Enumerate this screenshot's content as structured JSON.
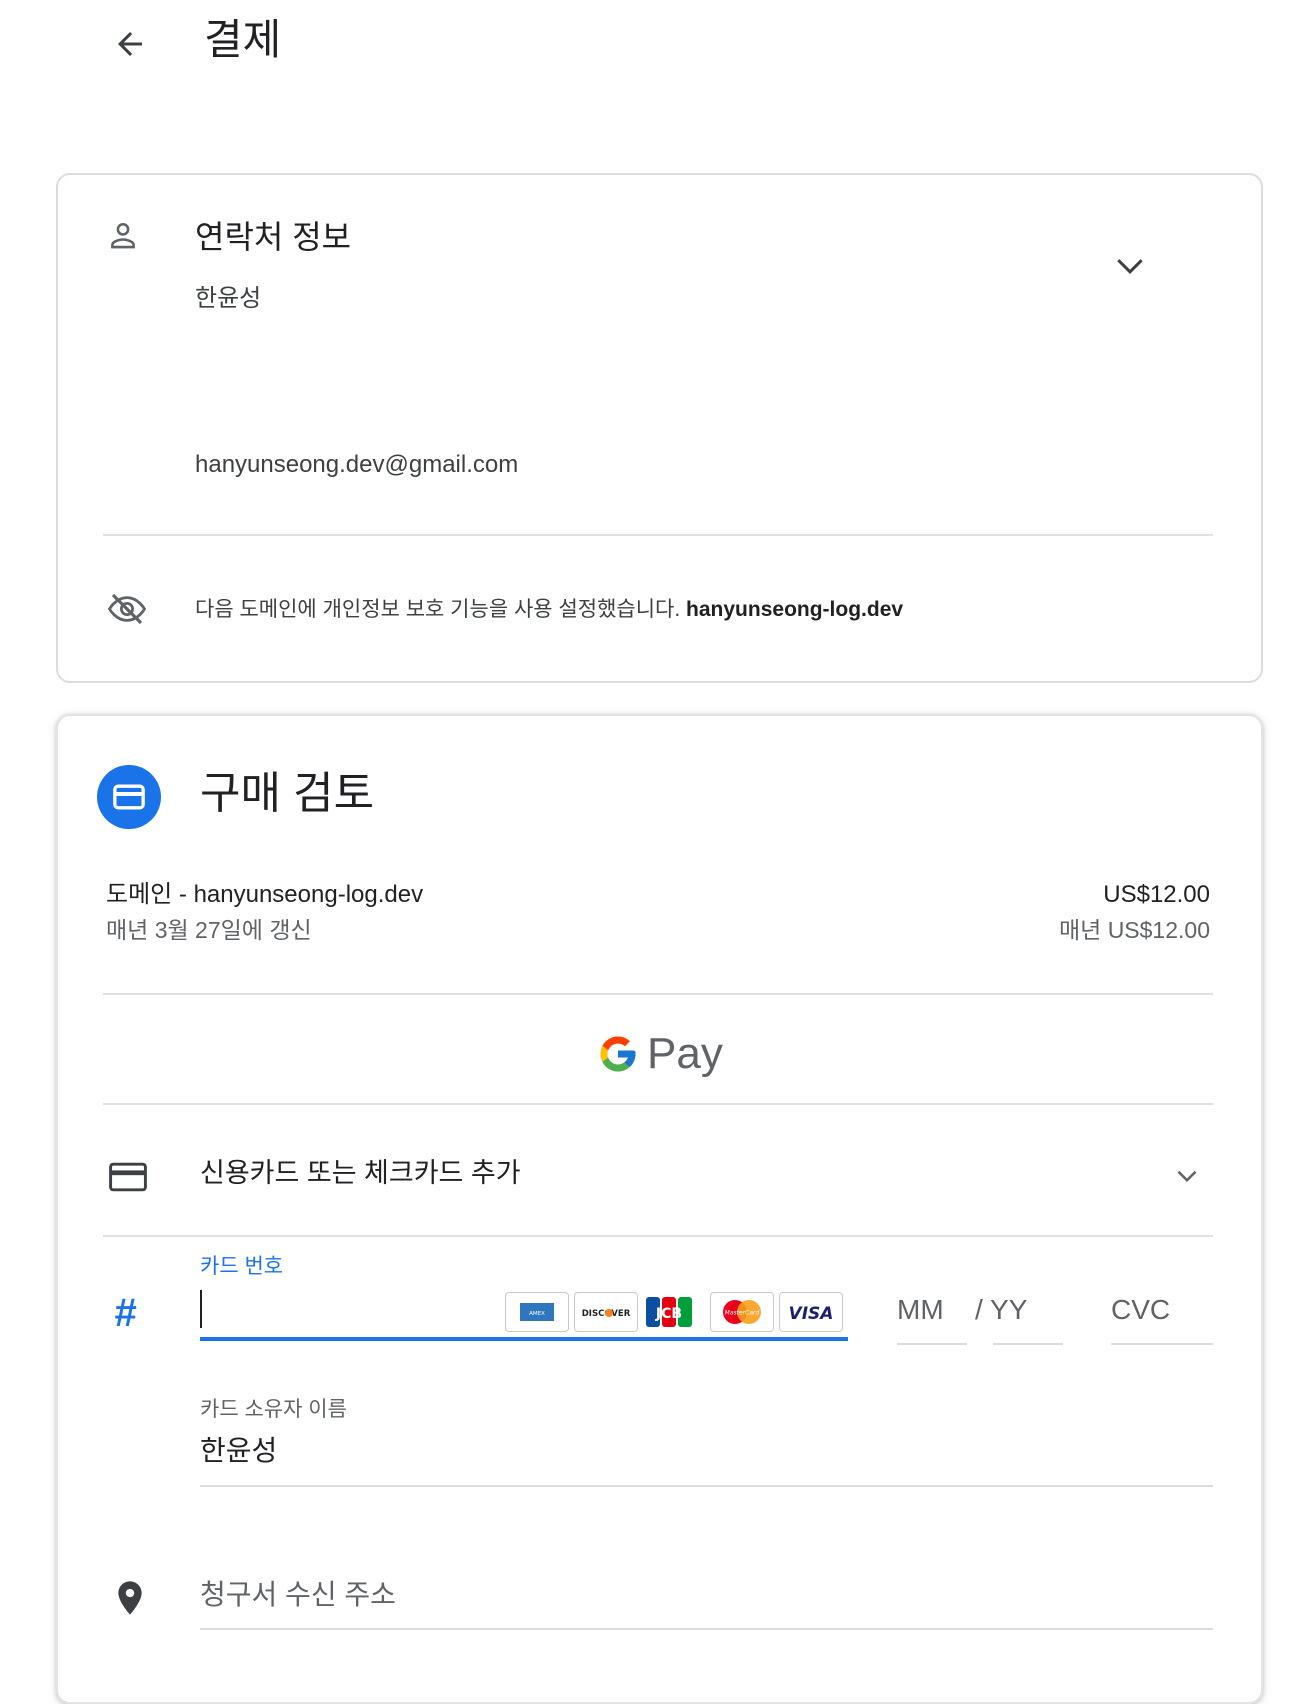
{
  "header": {
    "back_icon": "arrow-left-icon",
    "title": "결제"
  },
  "contact": {
    "icon": "person-icon",
    "title": "연락처 정보",
    "name": "한윤성",
    "email": "hanyunseong.dev@gmail.com",
    "expand_icon": "chevron-down-icon",
    "privacy_icon": "eye-off-icon",
    "privacy_text": "다음 도메인에 개인정보 보호 기능을 사용 설정했습니다.",
    "privacy_domain": "hanyunseong-log.dev"
  },
  "review": {
    "icon": "credit-card-icon",
    "title": "구매 검토",
    "item_name": "도메인 - hanyunseong-log.dev",
    "item_renewal": "매년 3월 27일에 갱신",
    "price": "US$12.00",
    "price_yearly": "매년 US$12.00",
    "gpay_label": "Pay",
    "add_card_label": "신용카드 또는 체크카드 추가",
    "card_number_label": "카드 번호",
    "card_number_value": "",
    "card_brands": [
      "AMEX",
      "DISCOVER",
      "JCB",
      "MasterCard",
      "VISA"
    ],
    "mm_placeholder": "MM",
    "yy_placeholder": "/ YY",
    "cvc_placeholder": "CVC",
    "cardholder_label": "카드 소유자 이름",
    "cardholder_value": "한윤성",
    "billing_address_placeholder": "청구서 수신 주소",
    "accent_color": "#1a73e8"
  }
}
